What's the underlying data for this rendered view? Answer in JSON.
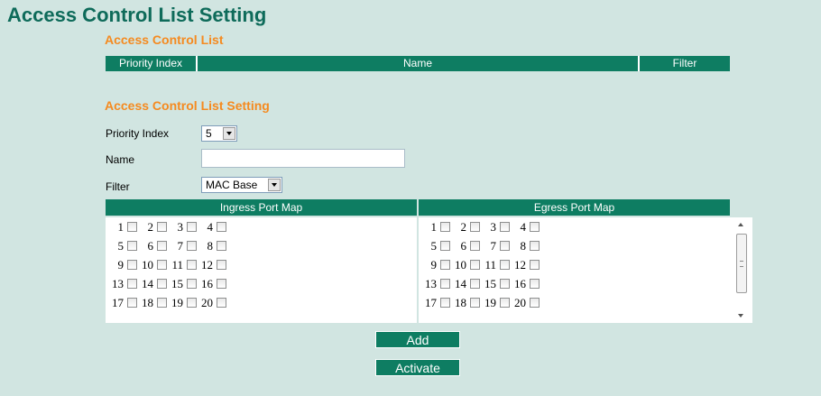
{
  "page": {
    "title": "Access Control List Setting"
  },
  "acl_list": {
    "section_title": "Access Control List",
    "columns": [
      "Priority Index",
      "Name",
      "Filter"
    ]
  },
  "setting": {
    "section_title": "Access Control List Setting",
    "priority_label": "Priority Index",
    "priority_value": "5",
    "name_label": "Name",
    "name_value": "",
    "filter_label": "Filter",
    "filter_value": "MAC Base"
  },
  "ingress": {
    "header": "Ingress Port Map",
    "ports": [
      [
        "1",
        "2",
        "3",
        "4"
      ],
      [
        "5",
        "6",
        "7",
        "8"
      ],
      [
        "9",
        "10",
        "11",
        "12"
      ],
      [
        "13",
        "14",
        "15",
        "16"
      ],
      [
        "17",
        "18",
        "19",
        "20"
      ]
    ]
  },
  "egress": {
    "header": "Egress Port Map",
    "ports": [
      [
        "1",
        "2",
        "3",
        "4"
      ],
      [
        "5",
        "6",
        "7",
        "8"
      ],
      [
        "9",
        "10",
        "11",
        "12"
      ],
      [
        "13",
        "14",
        "15",
        "16"
      ],
      [
        "17",
        "18",
        "19",
        "20"
      ]
    ]
  },
  "buttons": {
    "add": "Add",
    "activate": "Activate"
  },
  "colors": {
    "accent": "#0e7d62",
    "section": "#f58a1f",
    "background": "#d1e5e1"
  }
}
